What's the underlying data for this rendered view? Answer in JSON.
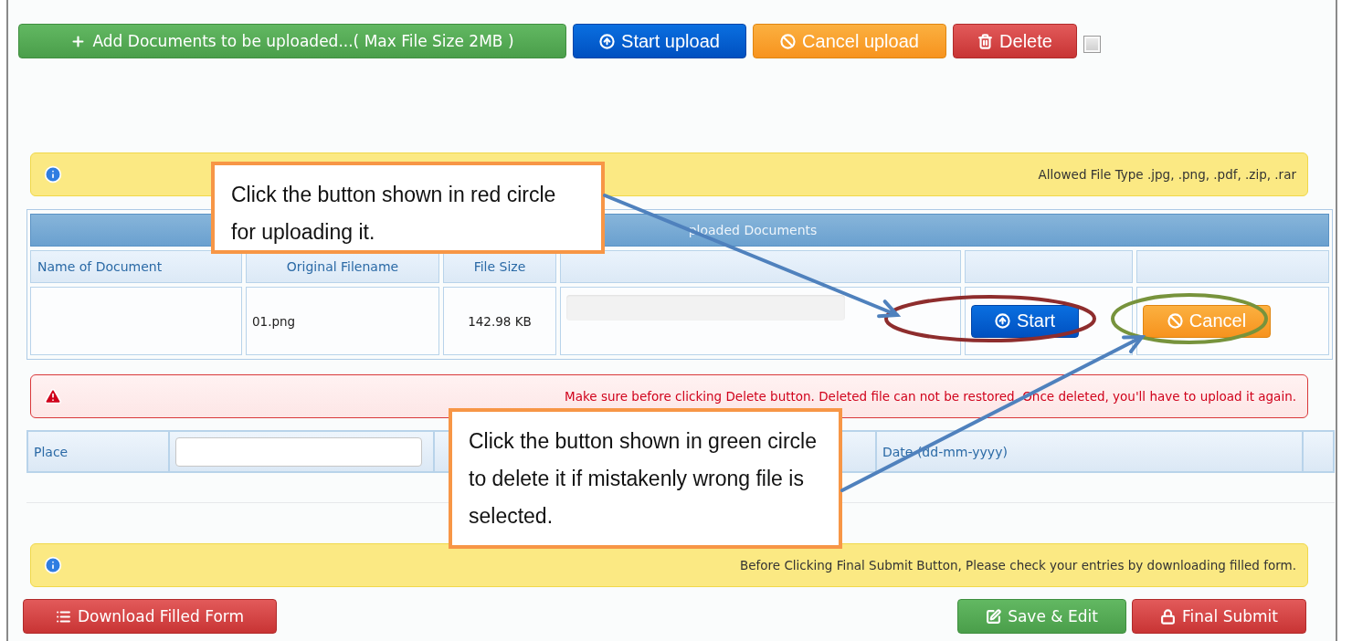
{
  "toolbar": {
    "buttons": [
      {
        "kind": "add",
        "label": "Add Documents to be uploaded...( Max File Size 2MB )"
      },
      {
        "kind": "start",
        "label": "Start upload"
      },
      {
        "kind": "cancel",
        "label": "Cancel upload"
      },
      {
        "kind": "delete",
        "label": "Delete"
      }
    ],
    "select_all": {
      "checked": false
    }
  },
  "info_bar": {
    "text": "Allowed File Type .jpg, .png, .pdf, .zip, .rar"
  },
  "table": {
    "title": "ploaded Documents",
    "columns": [
      "Name of Document",
      "Original Filename",
      "File Size"
    ],
    "rows": [
      {
        "original_filename": "01.png",
        "file_size": "142.98 KB",
        "start_button": "Start",
        "cancel_button": "Cancel"
      }
    ]
  },
  "warning": {
    "text": "Make sure before clicking Delete button. Deleted file can not be restored. Once deleted, you'll have to upload it again."
  },
  "place_date": {
    "place_label": "Place",
    "date_label": "Date (dd-mm-yyyy)"
  },
  "notice": {
    "text": "Before Clicking Final Submit Button, Please check your entries by downloading filled form."
  },
  "footer": {
    "buttons": [
      {
        "kind": "download",
        "label": "Download Filled Form"
      },
      {
        "kind": "save",
        "label": "Save & Edit"
      },
      {
        "kind": "submit",
        "label": "Final Submit"
      }
    ]
  },
  "annotations": [
    {
      "text": "Click the button shown in red circle for uploading it.",
      "color": "#8e2d2d"
    },
    {
      "text": "Click the button shown in green circle to delete it if mistakenly wrong file is selected.",
      "color": "#77933c"
    }
  ]
}
